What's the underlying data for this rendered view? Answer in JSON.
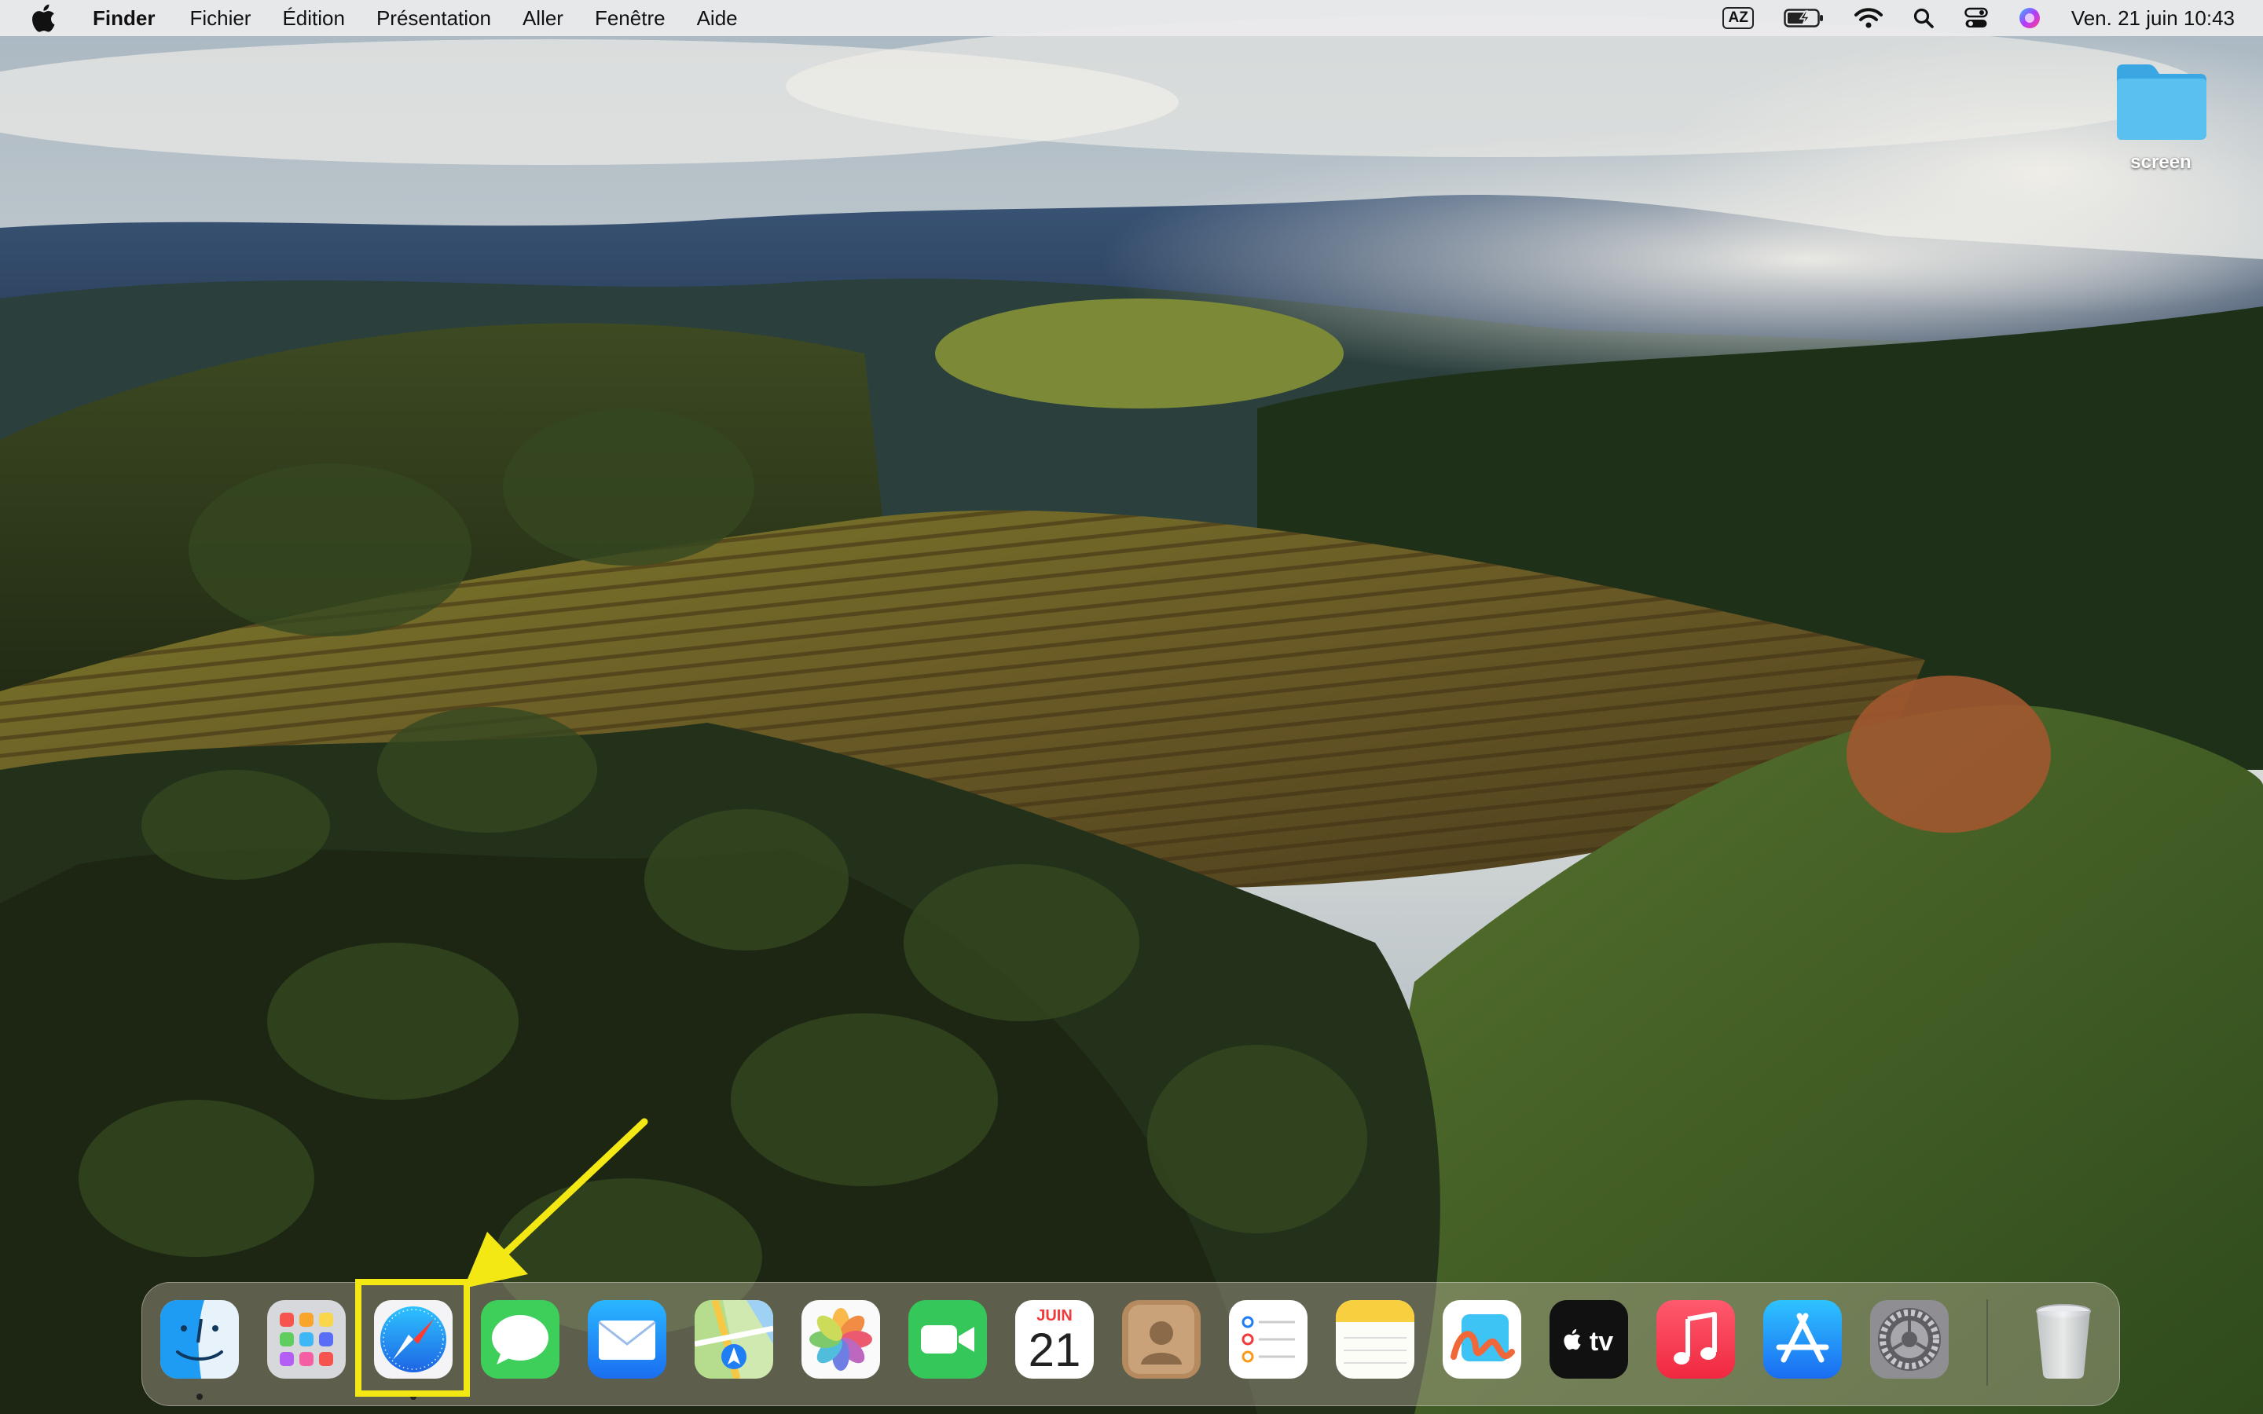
{
  "menubar": {
    "apple_icon": "apple-logo-icon",
    "app_name": "Finder",
    "menus": [
      "Fichier",
      "Édition",
      "Présentation",
      "Aller",
      "Fenêtre",
      "Aide"
    ],
    "status": {
      "keyboard_layout": "AZ",
      "battery_icon": "battery-charging-icon",
      "wifi_icon": "wifi-icon",
      "search_icon": "spotlight-search-icon",
      "control_center_icon": "control-center-icon",
      "siri_icon": "siri-icon",
      "clock": "Ven. 21 juin  10:43"
    }
  },
  "desktop": {
    "folder": {
      "label": "screen",
      "icon": "folder-icon",
      "color": "#5ac0f0"
    }
  },
  "dock": {
    "apps": [
      {
        "name": "Finder",
        "icon": "finder-icon",
        "running": true
      },
      {
        "name": "Launchpad",
        "icon": "launchpad-icon",
        "running": false
      },
      {
        "name": "Safari",
        "icon": "safari-icon",
        "running": true,
        "highlighted": true
      },
      {
        "name": "Messages",
        "icon": "messages-icon",
        "running": false
      },
      {
        "name": "Mail",
        "icon": "mail-icon",
        "running": false
      },
      {
        "name": "Plans",
        "icon": "maps-icon",
        "running": false
      },
      {
        "name": "Photos",
        "icon": "photos-icon",
        "running": false
      },
      {
        "name": "FaceTime",
        "icon": "facetime-icon",
        "running": false
      },
      {
        "name": "Calendrier",
        "icon": "calendar-icon",
        "running": false
      },
      {
        "name": "Contacts",
        "icon": "contacts-icon",
        "running": false
      },
      {
        "name": "Rappels",
        "icon": "reminders-icon",
        "running": false
      },
      {
        "name": "Notes",
        "icon": "notes-icon",
        "running": false
      },
      {
        "name": "Freeform",
        "icon": "freeform-icon",
        "running": false
      },
      {
        "name": "Apple TV",
        "icon": "apple-tv-icon",
        "running": false
      },
      {
        "name": "Musique",
        "icon": "music-icon",
        "running": false
      },
      {
        "name": "App Store",
        "icon": "app-store-icon",
        "running": false
      },
      {
        "name": "Réglages Système",
        "icon": "system-settings-icon",
        "running": false
      },
      {
        "name": "Corbeille",
        "icon": "trash-icon",
        "running": false
      }
    ],
    "calendar": {
      "month": "JUIN",
      "day": "21"
    },
    "appletv_label": "tv"
  },
  "annotation": {
    "color": "#f3e814",
    "target": "safari-icon"
  }
}
